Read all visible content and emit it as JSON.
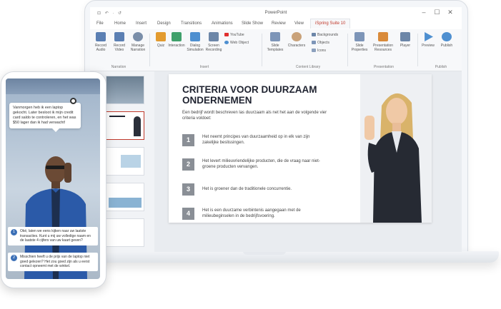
{
  "window": {
    "title": "PowerPoint",
    "quick_access": "⊡ ↶ · ↺",
    "controls": {
      "minimize": "–",
      "maximize": "☐",
      "close": "✕"
    }
  },
  "tabs": [
    {
      "label": "File"
    },
    {
      "label": "Home"
    },
    {
      "label": "Insert"
    },
    {
      "label": "Design"
    },
    {
      "label": "Transitions"
    },
    {
      "label": "Animations"
    },
    {
      "label": "Slide Show"
    },
    {
      "label": "Review"
    },
    {
      "label": "View"
    },
    {
      "label": "iSpring Suite 10",
      "active": true
    }
  ],
  "ribbon": {
    "narration": {
      "group_label": "Narration",
      "record_audio": "Record Audio",
      "record_video": "Record Video",
      "manage_narration": "Manage Narration"
    },
    "insert": {
      "group_label": "Insert",
      "quiz": "Quiz",
      "interaction": "Interaction",
      "dialog_simulation": "Dialog Simulation",
      "screen_recording": "Screen Recording",
      "youtube": "YouTube",
      "web_object": "Web Object"
    },
    "content_library": {
      "group_label": "Content Library",
      "slide_templates": "Slide Templates",
      "characters": "Characters",
      "backgrounds": "Backgrounds",
      "objects": "Objects",
      "icons": "Icons"
    },
    "presentation": {
      "group_label": "Presentation",
      "slide_properties": "Slide Properties",
      "presentation_resources": "Presentation Resources",
      "player": "Player"
    },
    "publish": {
      "group_label": "Publish",
      "preview": "Preview",
      "publish": "Publish"
    }
  },
  "slide": {
    "title": "CRITERIA VOOR DUURZAAM ONDERNEMEN",
    "intro": "Een bedrijf wordt beschreven las duurzaam als net het aan de volgende vier criteria voldoet:",
    "criteria": [
      {
        "num": "1",
        "text": "Het neemt principes van duurzaamheid op in elk van zijn zakelijke beslissingen."
      },
      {
        "num": "2",
        "text": "Het levert milieuvriendelijke producten, die de vraag naar niet-groene producten vervangen."
      },
      {
        "num": "3",
        "text": "Het is groener dan de traditionele concurrentie."
      },
      {
        "num": "4",
        "text": "Het is een duurzame verbintenis aangegaan met de milieubeginselen in de bedrijfsvoering."
      }
    ]
  },
  "phone": {
    "bubble": "Vanmorgen heb ik een laptop gekocht. Later besloot ik mijn credit card saldo te controleren, en het was $50 lager dan ik had verwacht!",
    "choices": [
      {
        "num": "1",
        "text": "Oké, laten we eens kijken naar uw laatste transacties. Kunt u mij uw volledige naam en de laatste 4 cijfers van uw kaart geven?"
      },
      {
        "num": "2",
        "text": "Misschien heeft u de prijs van de laptop niet goed gelezen? Het zou goed zijn als u eerst contact opneemt met de winkel."
      }
    ]
  },
  "colors": {
    "accent_red": "#c0392b",
    "title_dark": "#1f2330",
    "number_gray": "#8a8f96",
    "choice_blue": "#3b6fb6"
  }
}
